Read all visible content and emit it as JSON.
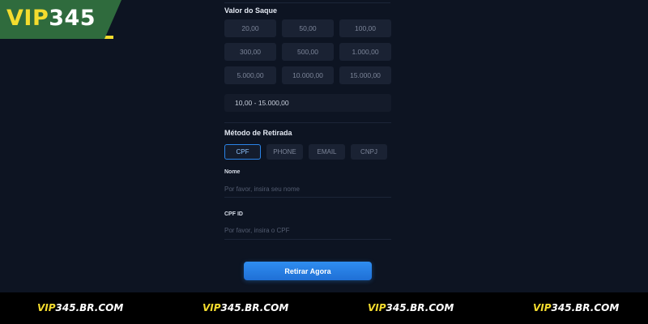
{
  "brand": {
    "logo_vip": "VIP",
    "logo_number": "345",
    "colors": {
      "accent": "#2b84e8",
      "logo_bg": "#2f6b3d",
      "logo_yellow": "#f4dc2e"
    }
  },
  "withdraw": {
    "amount_section_label": "Valor do Saque",
    "amounts": [
      "20,00",
      "50,00",
      "100,00",
      "300,00",
      "500,00",
      "1.000,00",
      "5.000,00",
      "10.000,00",
      "15.000,00"
    ],
    "range": "10,00 - 15.000,00",
    "method_section_label": "Método de Retirada",
    "methods": [
      "CPF",
      "PHONE",
      "EMAIL",
      "CNPJ"
    ],
    "selected_method": "CPF",
    "name_field": {
      "label": "Nome",
      "value": "",
      "placeholder": "Por favor, insira seu nome"
    },
    "cpf_field": {
      "label": "CPF ID",
      "value": "",
      "placeholder": "Por favor, insira o CPF"
    },
    "submit_label": "Retirar Agora"
  },
  "footer": {
    "items": [
      {
        "vip": "VIP",
        "rest": "345.BR.COM"
      },
      {
        "vip": "VIP",
        "rest": "345.BR.COM"
      },
      {
        "vip": "VIP",
        "rest": "345.BR.COM"
      },
      {
        "vip": "VIP",
        "rest": "345.BR.COM"
      }
    ]
  }
}
